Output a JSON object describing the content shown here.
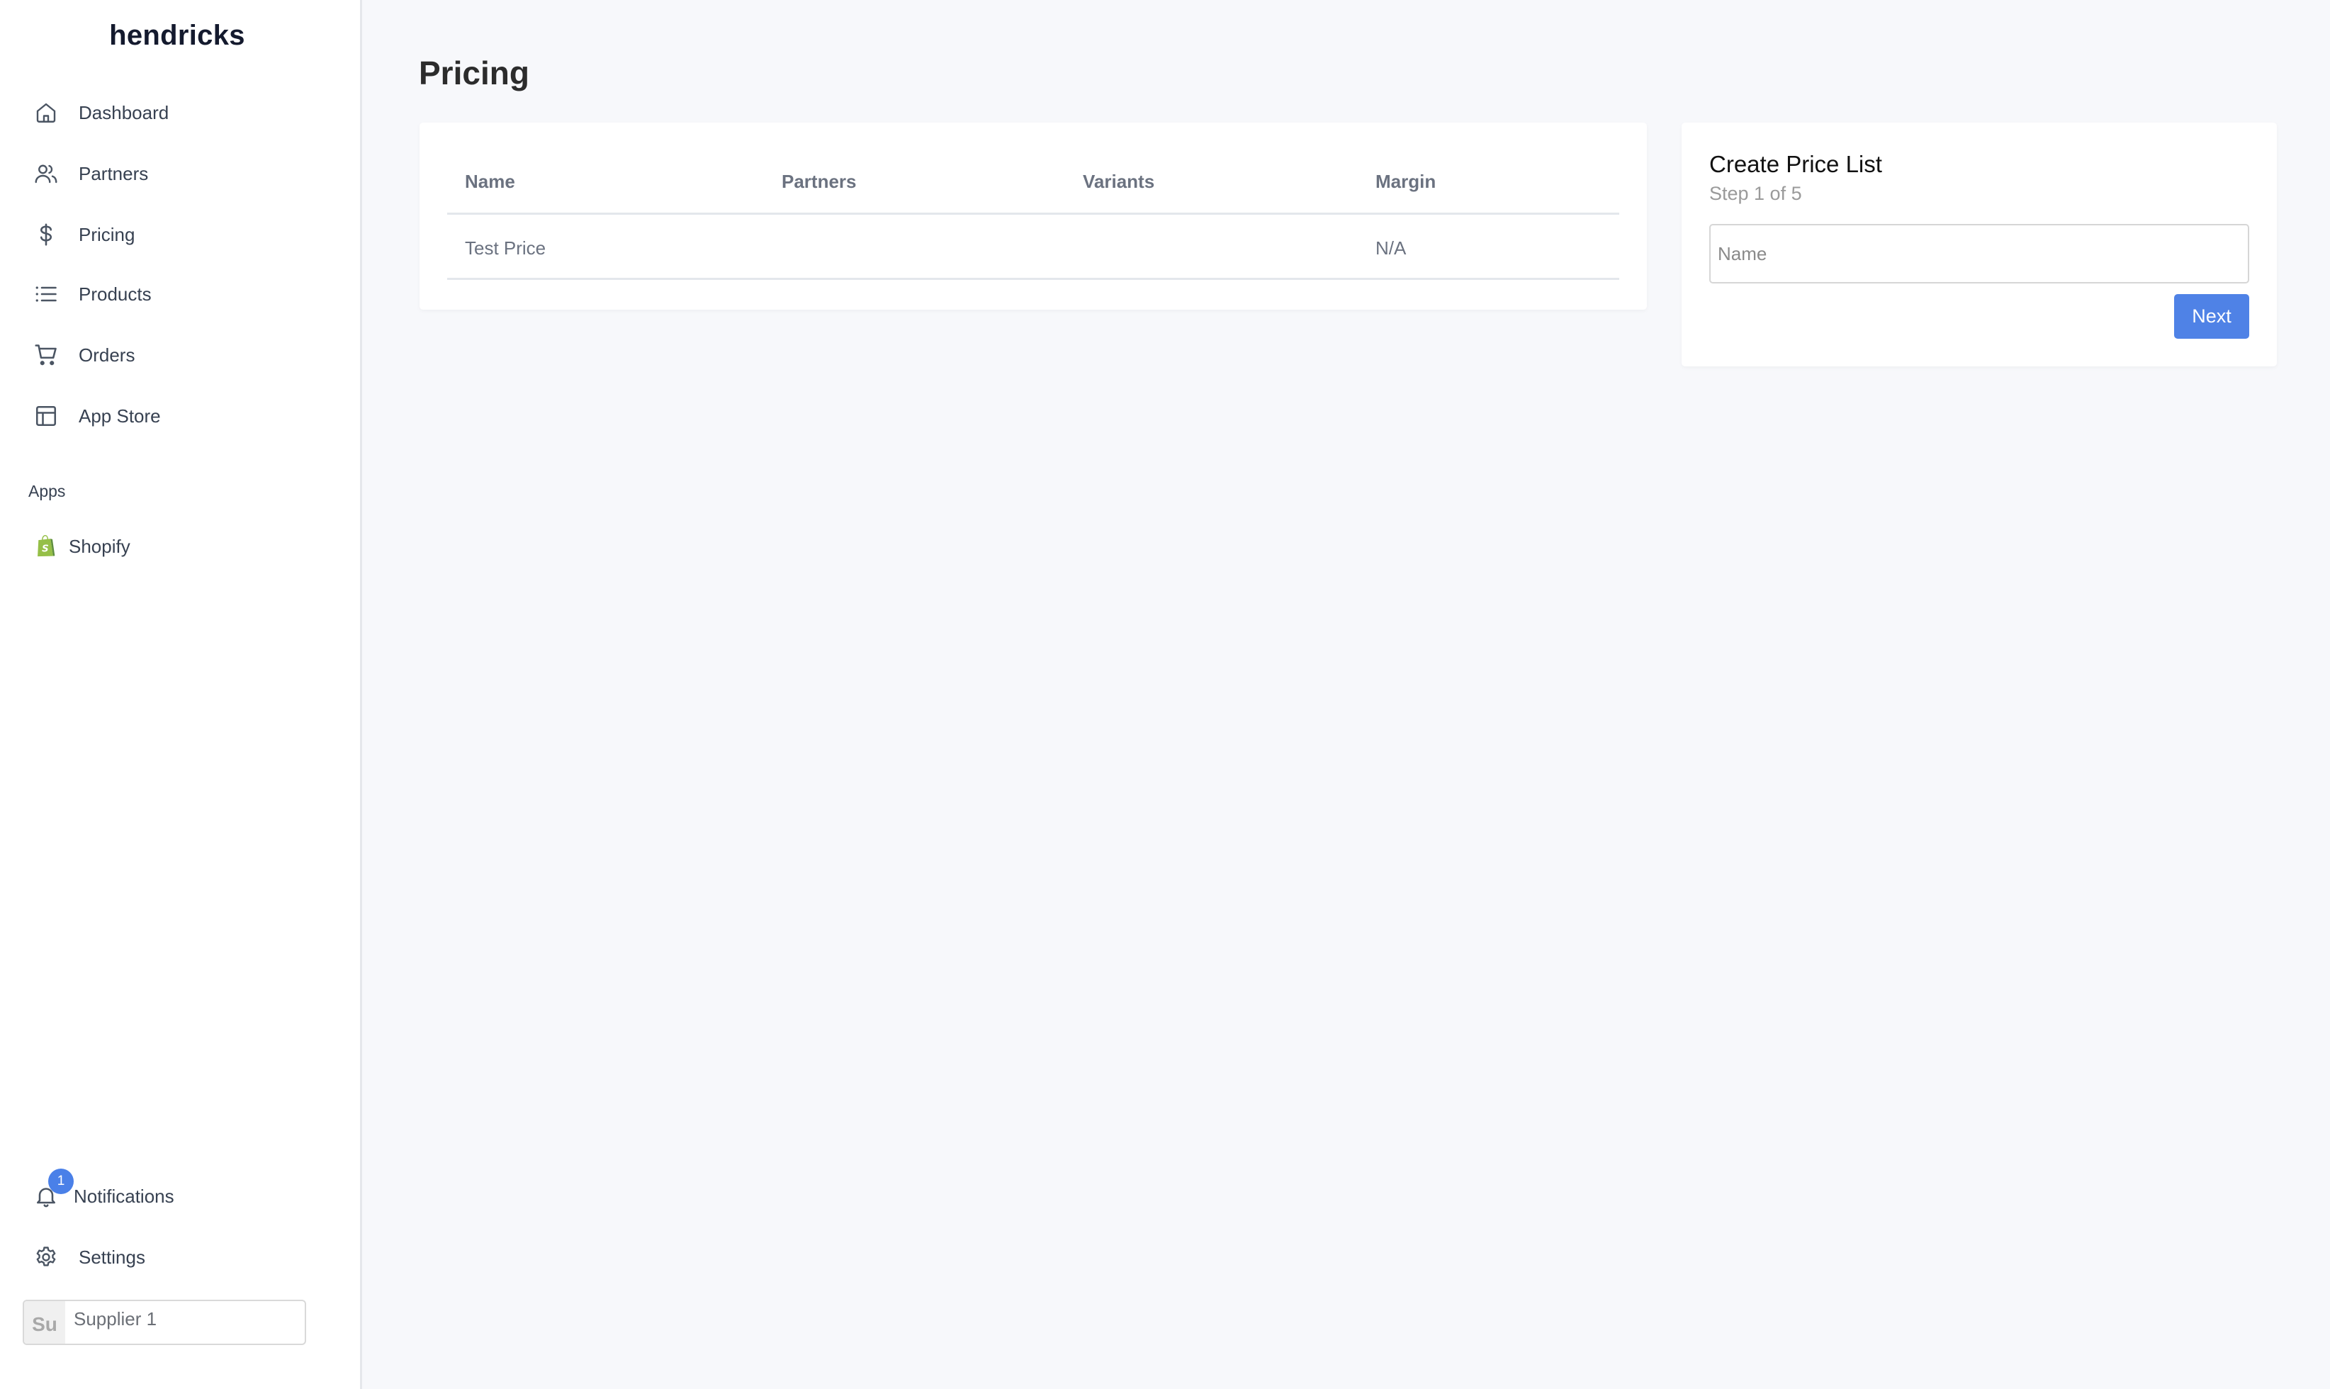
{
  "app": {
    "brand": "hendricks"
  },
  "sidebar": {
    "nav": [
      {
        "label": "Dashboard",
        "icon": "home-icon"
      },
      {
        "label": "Partners",
        "icon": "users-icon"
      },
      {
        "label": "Pricing",
        "icon": "dollar-icon"
      },
      {
        "label": "Products",
        "icon": "list-icon"
      },
      {
        "label": "Orders",
        "icon": "cart-icon"
      },
      {
        "label": "App Store",
        "icon": "layout-icon"
      }
    ],
    "apps_heading": "Apps",
    "apps": [
      {
        "label": "Shopify",
        "icon": "shopify-icon"
      }
    ],
    "notifications": {
      "label": "Notifications",
      "count": "1",
      "icon": "bell-icon"
    },
    "settings": {
      "label": "Settings",
      "icon": "gear-icon"
    },
    "account": {
      "initials": "Su",
      "name": "Supplier 1"
    }
  },
  "main": {
    "title": "Pricing",
    "table": {
      "columns": [
        "Name",
        "Partners",
        "Variants",
        "Margin"
      ],
      "rows": [
        [
          "Test Price",
          "",
          "",
          "N/A"
        ]
      ]
    },
    "create_price_list": {
      "title": "Create Price List",
      "step": "Step 1 of 5",
      "name_placeholder": "Name",
      "name_value": "",
      "next_label": "Next"
    }
  },
  "colors": {
    "accent": "#4f82e6",
    "badge": "#4a80e8",
    "background": "#f7f8fb",
    "shopify_green": "#95bf47"
  }
}
